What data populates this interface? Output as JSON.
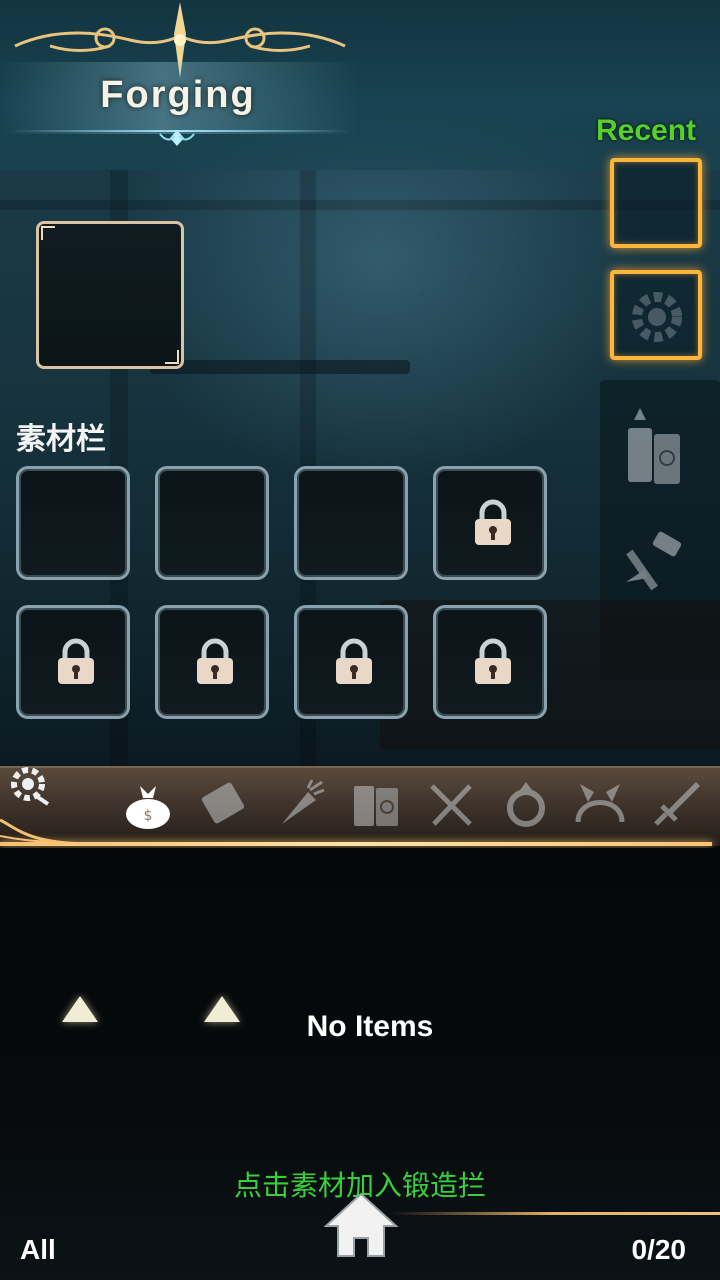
{
  "header": {
    "title": "Forging"
  },
  "recent": {
    "label": "Recent",
    "slots": [
      "empty",
      "gear-item"
    ]
  },
  "main_slot": {
    "state": "empty"
  },
  "materials": {
    "label": "素材栏",
    "slots": [
      {
        "locked": false
      },
      {
        "locked": false
      },
      {
        "locked": false
      },
      {
        "locked": true
      },
      {
        "locked": true
      },
      {
        "locked": true
      },
      {
        "locked": true
      },
      {
        "locked": true
      }
    ]
  },
  "side_icons": [
    "books-icon",
    "hammer-icon"
  ],
  "categories": {
    "settings_icon": "gear-icon",
    "items": [
      "bag-icon",
      "scroll-icon",
      "carrot-icon",
      "book-icon",
      "cutlery-icon",
      "ring-icon",
      "headband-icon",
      "sword-icon"
    ],
    "active": "bag-icon"
  },
  "list": {
    "empty_text": "No Items"
  },
  "footer": {
    "hint": "点击素材加入锻造拦",
    "filter_label": "All",
    "count": "0/20",
    "home_icon": "home-icon"
  },
  "colors": {
    "accent_gold": "#ffb43a",
    "recent_green": "#55d12a",
    "hint_green": "#38d03a"
  }
}
